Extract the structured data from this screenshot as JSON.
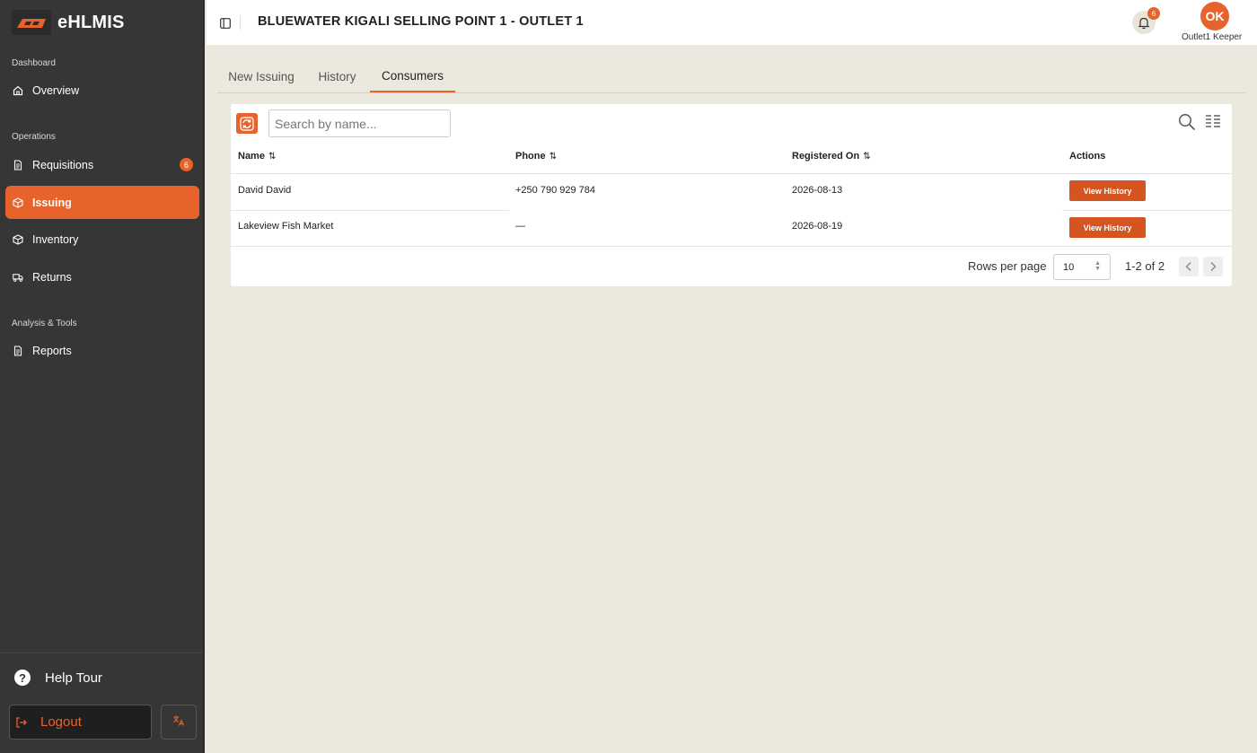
{
  "app": {
    "name": "eHLMIS"
  },
  "sidebar": {
    "sections": [
      {
        "label": "Dashboard"
      },
      {
        "label": "Operations"
      },
      {
        "label": "Analysis & Tools"
      }
    ],
    "items": [
      {
        "label": "Overview",
        "icon": "home-icon"
      },
      {
        "label": "Requisitions",
        "icon": "document-icon",
        "badge": "6"
      },
      {
        "label": "Issuing",
        "icon": "box-icon",
        "active": true
      },
      {
        "label": "Inventory",
        "icon": "box-icon"
      },
      {
        "label": "Returns",
        "icon": "truck-icon"
      },
      {
        "label": "Reports",
        "icon": "document-icon"
      }
    ],
    "help_tour": "Help Tour",
    "logout": "Logout"
  },
  "header": {
    "title": "BLUEWATER KIGALI SELLING POINT 1 - OUTLET 1",
    "notification_count": "6",
    "avatar_initials": "OK",
    "user_name": "Outlet1 Keeper"
  },
  "tabs": [
    {
      "label": "New Issuing"
    },
    {
      "label": "History"
    },
    {
      "label": "Consumers",
      "active": true
    }
  ],
  "search": {
    "placeholder": "Search by name..."
  },
  "table": {
    "columns": [
      {
        "label": "Name",
        "sort_icon": "⇅"
      },
      {
        "label": "Phone",
        "sort_icon": "⇅"
      },
      {
        "label": "Registered On",
        "sort_icon": "⇅"
      },
      {
        "label": "Actions"
      }
    ],
    "rows": [
      {
        "name": "David David",
        "phone": "+250 790 929 784",
        "registered_on": "2026-08-13",
        "action": "View History"
      },
      {
        "name": "Lakeview Fish Market",
        "phone": "—",
        "registered_on": "2026-08-19",
        "action": "View History"
      }
    ]
  },
  "pagination": {
    "rows_per_page_label": "Rows per page",
    "rows_per_page_value": "10",
    "range": "1-2 of 2"
  },
  "colors": {
    "accent": "#e8622c",
    "sidebar_bg": "#363636",
    "page_bg": "#ebe9de"
  }
}
